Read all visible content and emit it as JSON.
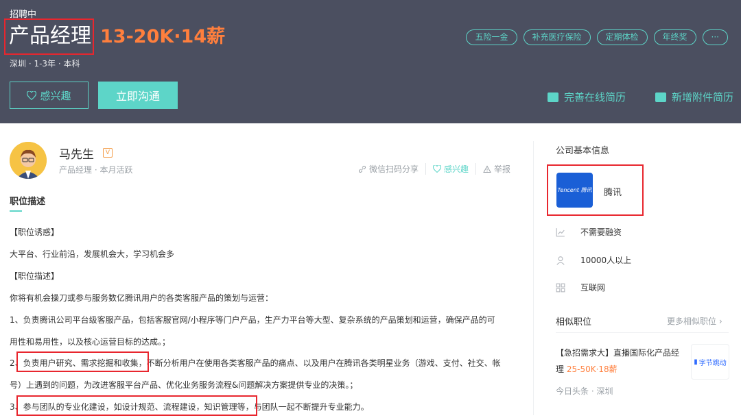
{
  "header": {
    "status": "招聘中",
    "title": "产品经理",
    "salary": "13-20K·14薪",
    "meta": "深圳 · 1-3年 · 本科",
    "tags": [
      "五险一金",
      "补充医疗保险",
      "定期体检",
      "年终奖",
      "···"
    ],
    "interest_label": "感兴趣",
    "chat_label": "立即沟通",
    "resume_online": "完善在线简历",
    "resume_attach": "新增附件简历"
  },
  "recruiter": {
    "name": "马先生",
    "verified_badge": "V",
    "subtitle": "产品经理 · 本月活跃"
  },
  "actions": {
    "share": "微信扫码分享",
    "interest": "感兴趣",
    "report": "举报"
  },
  "description": {
    "section_title": "职位描述",
    "lines": [
      "【职位诱惑】",
      "大平台、行业前沿，发展机会大，学习机会多",
      "【职位描述】",
      "你将有机会操刀或参与服务数亿腾讯用户的各类客服产品的策划与运营：",
      "1、负责腾讯公司平台级客服产品，包括客服官网/小程序等门户产品，生产力平台等大型、复杂系统的产品策划和运营，确保产品的可",
      "用性和易用性，以及核心运营目标的达成。；",
      "2、负责用户研究、需求挖掘和收集，不断分析用户在使用各类客服产品的痛点、以及用户在腾讯各类明星业务（游戏、支付、社交、帐",
      "号）上遇到的问题，为改进客服平台产品、优化业务服务流程&问题解决方案提供专业的决策。；",
      "3、参与团队的专业化建设，如设计规范、流程建设，知识管理等，与团队一起不断提升专业能力。"
    ]
  },
  "company": {
    "section_title": "公司基本信息",
    "logo_text": "Tencent 腾讯",
    "name": "腾讯",
    "funding": "不需要融资",
    "size": "10000人以上",
    "industry": "互联网"
  },
  "similar": {
    "title": "相似职位",
    "more": "更多相似职位",
    "job_title": "【急招需求大】直播国际化产品经理",
    "job_salary": "25-50K·18薪",
    "logo_text": "字节跳动",
    "meta": "今日头条 · 深圳"
  },
  "colors": {
    "header_bg": "#4b4f60",
    "accent": "#5dd5c8",
    "salary": "#ff7f3d",
    "highlight_box": "#e8262e"
  }
}
